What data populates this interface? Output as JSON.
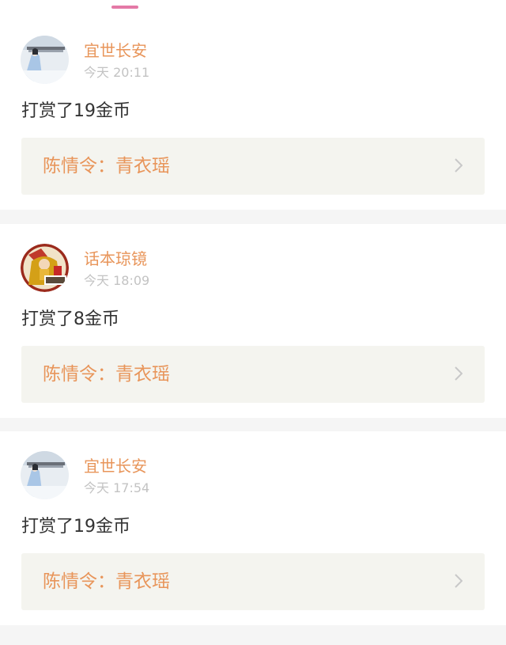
{
  "colors": {
    "accent_pink": "#e479a6",
    "username_orange": "#e8955a",
    "time_gray": "#c3c3c3",
    "link_box_bg": "#f4f4ef",
    "page_bg": "#f5f5f5"
  },
  "feed": [
    {
      "username": "宜世长安",
      "time": "今天 20:11",
      "message": "打赏了19金币",
      "link_text": "陈情令：青衣瑶",
      "avatar_icon": "snow-scene-avatar-icon",
      "link_icon": "chevron-right-icon"
    },
    {
      "username": "话本琼镜",
      "time": "今天 18:09",
      "message": "打赏了8金币",
      "link_text": "陈情令：青衣瑶",
      "avatar_icon": "opera-character-avatar-icon",
      "link_icon": "chevron-right-icon"
    },
    {
      "username": "宜世长安",
      "time": "今天 17:54",
      "message": "打赏了19金币",
      "link_text": "陈情令：青衣瑶",
      "avatar_icon": "snow-scene-avatar-icon",
      "link_icon": "chevron-right-icon"
    }
  ]
}
